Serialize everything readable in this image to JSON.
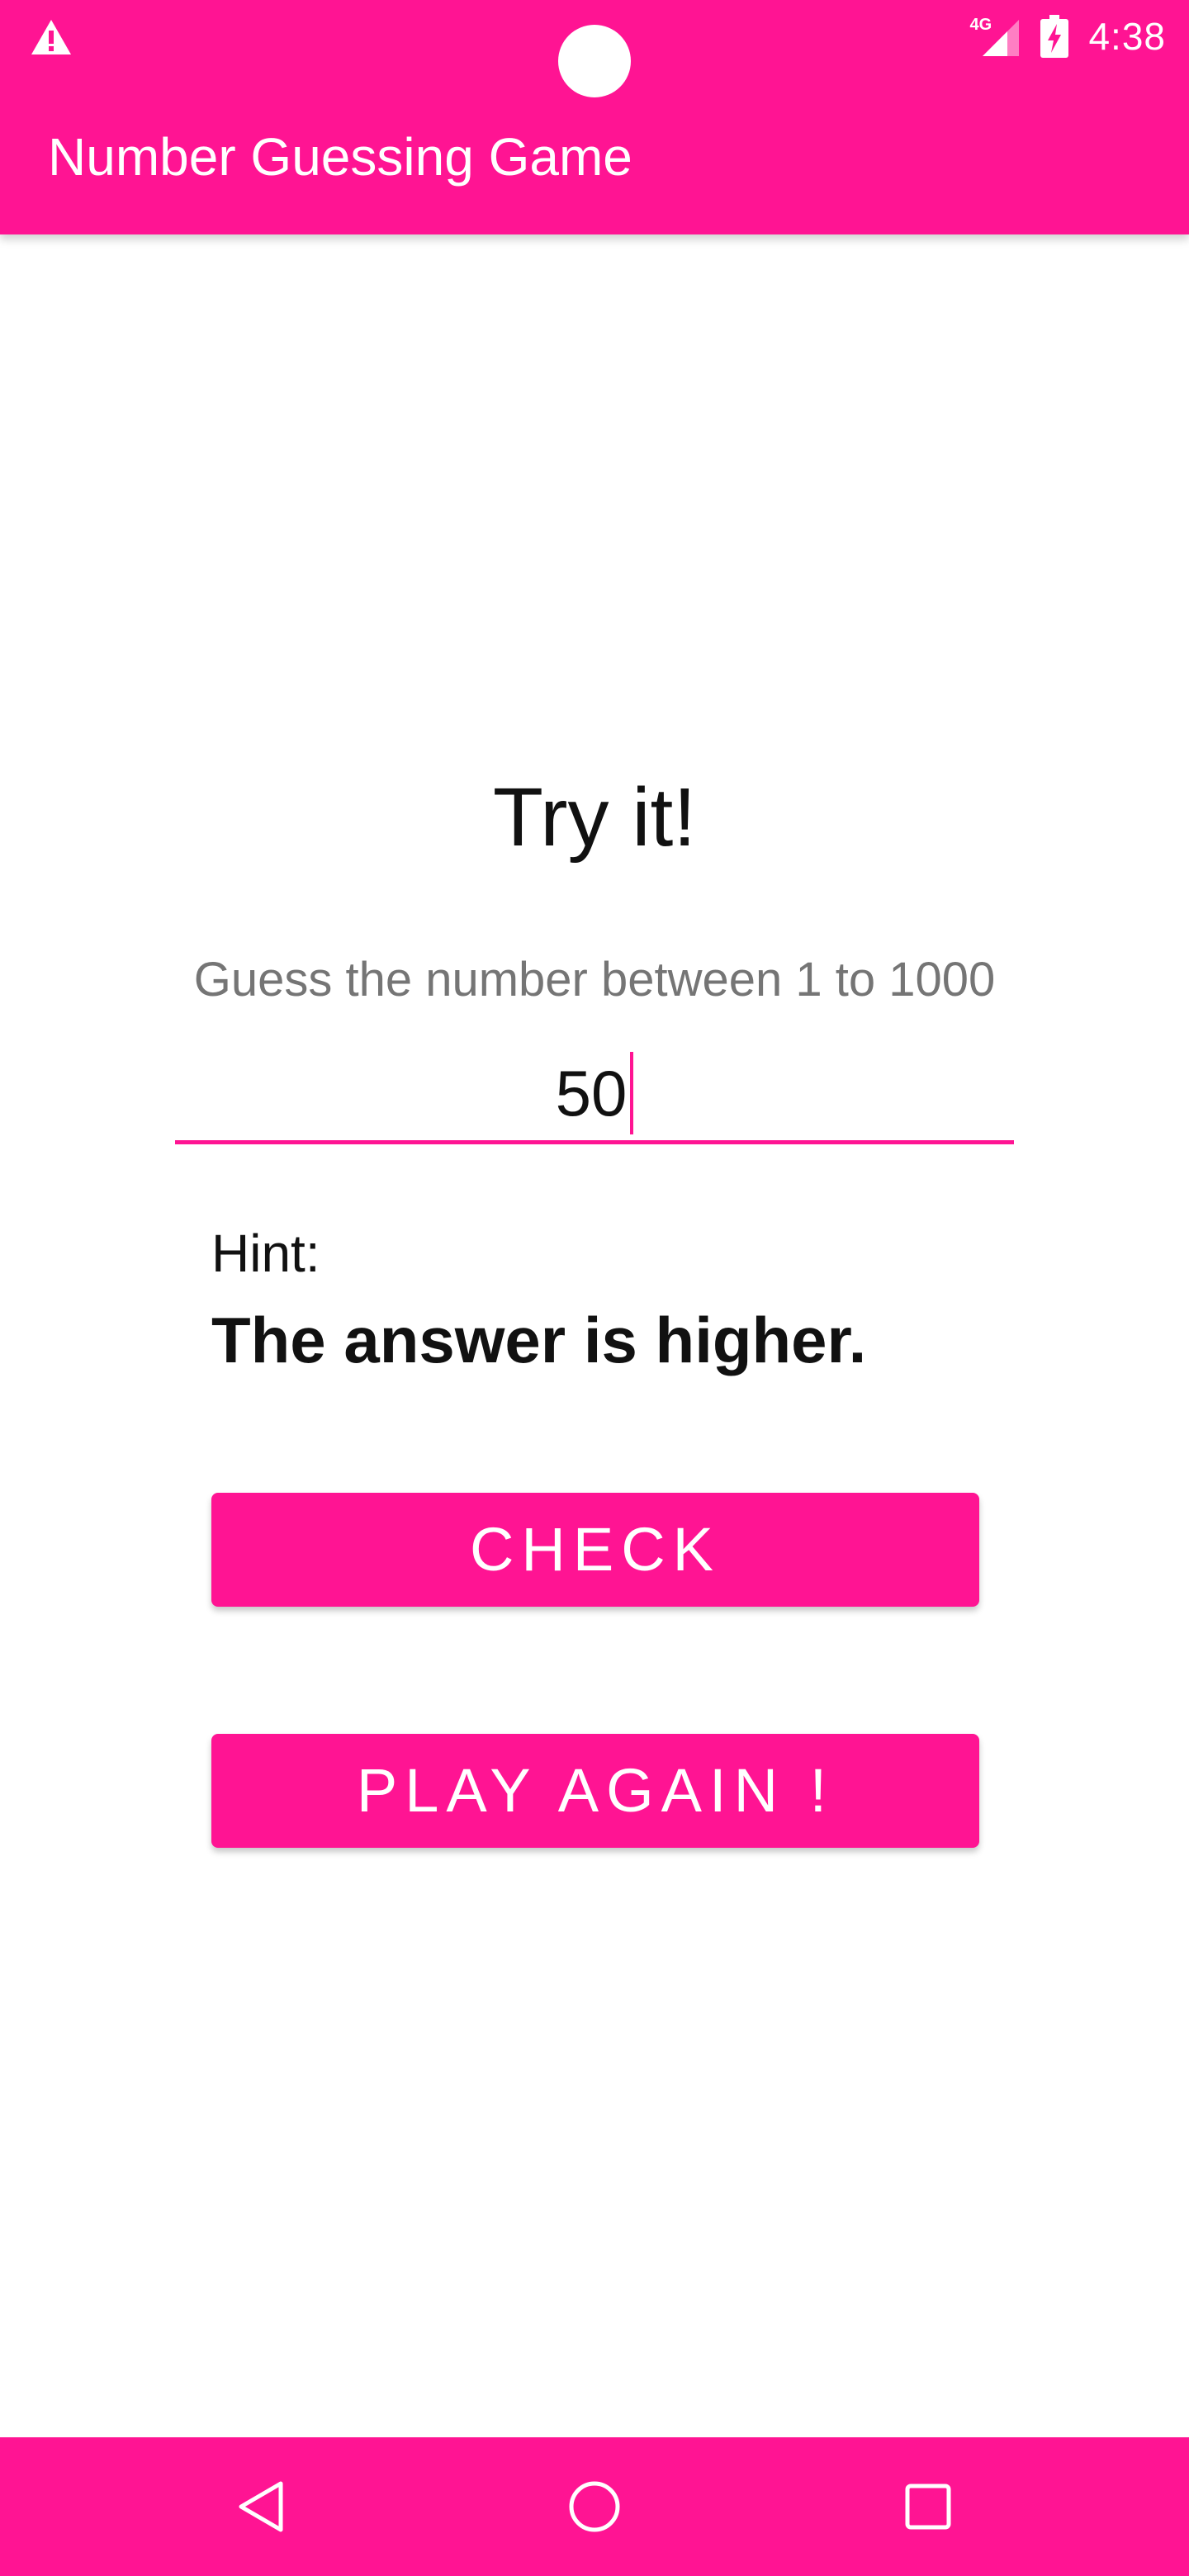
{
  "status_bar": {
    "network": "4G",
    "time": "4:38",
    "icons": [
      "warning-icon",
      "signal-icon",
      "battery-charging-icon"
    ]
  },
  "app_bar": {
    "title": "Number Guessing Game"
  },
  "game": {
    "heading": "Try it!",
    "instruction": "Guess the number between 1 to 1000",
    "guess_value": "50",
    "hint_label": "Hint:",
    "hint_text": "The answer is higher."
  },
  "buttons": {
    "check": "CHECK",
    "play_again": "PLAY AGAIN !"
  },
  "nav_bar": {
    "icons": [
      "back-icon",
      "home-icon",
      "recents-icon"
    ]
  },
  "colors": {
    "accent": "#ff1493",
    "text_primary": "#111111",
    "text_secondary": "#757575",
    "on_accent": "#ffffff"
  }
}
